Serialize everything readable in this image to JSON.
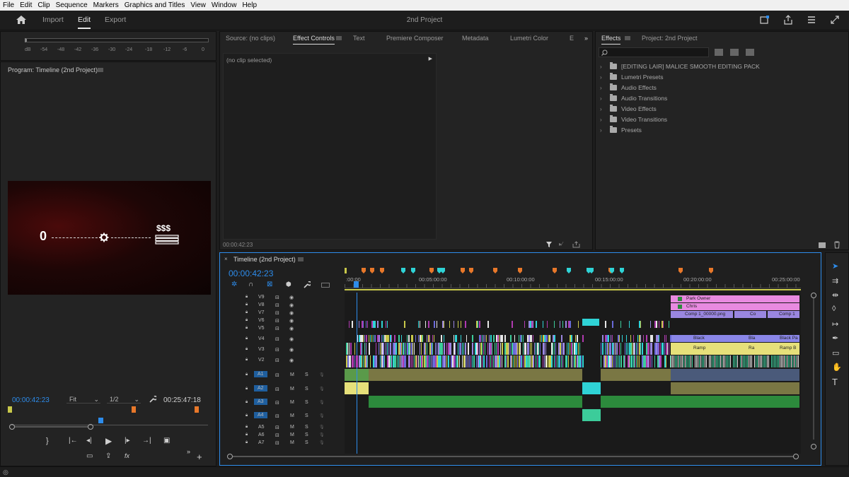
{
  "menu": [
    "File",
    "Edit",
    "Clip",
    "Sequence",
    "Markers",
    "Graphics and Titles",
    "View",
    "Window",
    "Help"
  ],
  "header": {
    "tabs": [
      "Import",
      "Edit",
      "Export"
    ],
    "active_tab": "Edit",
    "project_title": "2nd Project"
  },
  "meter": {
    "scale": [
      "dB",
      "-54",
      "-48",
      "-42",
      "-36",
      "-30",
      "-24",
      "-18",
      "-12",
      "-6",
      "0"
    ]
  },
  "program": {
    "title": "Program: Timeline (2nd Project)",
    "timecode": "00:00:42:23",
    "fit": "Fit",
    "resolution": "1/2",
    "duration": "00:25:47:18",
    "viewer_text": "0",
    "viewer_symbol": "$$$"
  },
  "effect_controls": {
    "tabs": [
      "Source: (no clips)",
      "Effect Controls",
      "Text",
      "Premiere Composer",
      "Metadata",
      "Lumetri Color",
      "E"
    ],
    "active_tab": "Effect Controls",
    "no_clip": "(no clip selected)",
    "timecode": "00:00:42:23"
  },
  "effects": {
    "tabs": [
      "Effects",
      "Project: 2nd Project"
    ],
    "active_tab": "Effects",
    "items": [
      "[EDITING LAIR] MALICE SMOOTH EDITING PACK",
      "Lumetri Presets",
      "Audio Effects",
      "Audio Transitions",
      "Video Effects",
      "Video Transitions",
      "Presets"
    ]
  },
  "timeline": {
    "title": "Timeline (2nd Project)",
    "timecode": "00:00:42:23",
    "ruler": [
      ":00:00",
      "00:05:00:00",
      "00:10:00:00",
      "00:15:00:00",
      "00:20:00:00",
      "00:25:00:00"
    ],
    "video_tracks": [
      "V9",
      "V8",
      "V7",
      "V6",
      "V5",
      "V4",
      "V3",
      "V2"
    ],
    "audio_tracks": [
      "A1",
      "A2",
      "A3",
      "A4",
      "A5",
      "A6",
      "A7"
    ],
    "clip_labels": {
      "park_owner": "Park Owner",
      "chris": "Chris",
      "comp": "Comp 1_00000.png",
      "co": "Co",
      "comp1": "Comp 1",
      "black": "Black",
      "bla": "Bla",
      "black_pa": "Black Pa",
      "ramp": "Ramp",
      "ra": "Ra",
      "ramp_b": "Ramp B",
      "fx": "fx"
    },
    "track_letters": {
      "m": "M",
      "s": "S"
    }
  },
  "colors": {
    "accent": "#2d8ceb",
    "marker_orange": "#e8782a",
    "marker_cyan": "#2fd3d6",
    "clip_pink": "#e88ae0",
    "clip_purple": "#9a86e0",
    "clip_yellow": "#e6e07a",
    "clip_green": "#2c8a3c",
    "clip_olive": "#7a7744",
    "clip_teal": "#3ccc9a"
  }
}
